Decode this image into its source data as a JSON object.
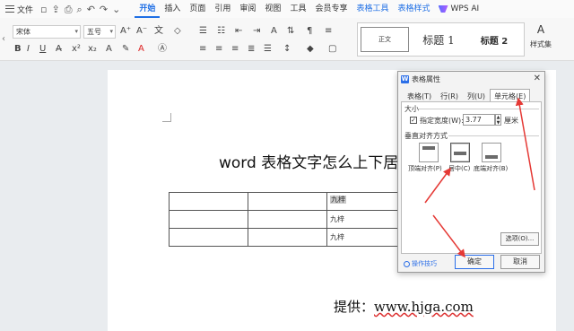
{
  "menubar": {
    "file_label": "文件",
    "tabs": [
      {
        "label": "开始",
        "active": true
      },
      {
        "label": "插入"
      },
      {
        "label": "页面"
      },
      {
        "label": "引用"
      },
      {
        "label": "审阅"
      },
      {
        "label": "视图"
      },
      {
        "label": "工具"
      },
      {
        "label": "会员专享"
      },
      {
        "label": "表格工具",
        "contextual": true
      },
      {
        "label": "表格样式",
        "contextual": true
      }
    ],
    "wps_ai_label": "WPS AI"
  },
  "ribbon": {
    "font_name": "宋体",
    "font_size": "五号",
    "styles": {
      "normal": "正文",
      "heading1": "标题 1",
      "heading2": "标题 2",
      "style_set_label": "样式集"
    }
  },
  "document": {
    "title": "word 表格文字怎么上下居",
    "table": {
      "rows": [
        [
          "",
          "",
          "九梓"
        ],
        [
          "",
          "",
          "九梓"
        ],
        [
          "",
          "",
          "九梓"
        ]
      ]
    },
    "provided_by": "提供：",
    "provided_url": "www.hjga.com"
  },
  "dialog": {
    "title": "表格属性",
    "tabs": [
      {
        "label": "表格(T)"
      },
      {
        "label": "行(R)"
      },
      {
        "label": "列(U)"
      },
      {
        "label": "单元格(E)",
        "active": true
      }
    ],
    "size_section": "大小",
    "specify_width_label": "指定宽度(W):",
    "width_value": "3.77",
    "unit_label": "厘米",
    "valign_section": "垂直对齐方式",
    "valign_options": [
      {
        "label": "顶端对齐(P)"
      },
      {
        "label": "居中(C)",
        "active": true
      },
      {
        "label": "底端对齐(B)"
      }
    ],
    "options_button": "选项(O)...",
    "tips_label": "操作技巧",
    "ok_button": "确定",
    "cancel_button": "取消"
  },
  "colors": {
    "accent": "#1f6fe5",
    "annotation_arrow": "#e53935"
  }
}
